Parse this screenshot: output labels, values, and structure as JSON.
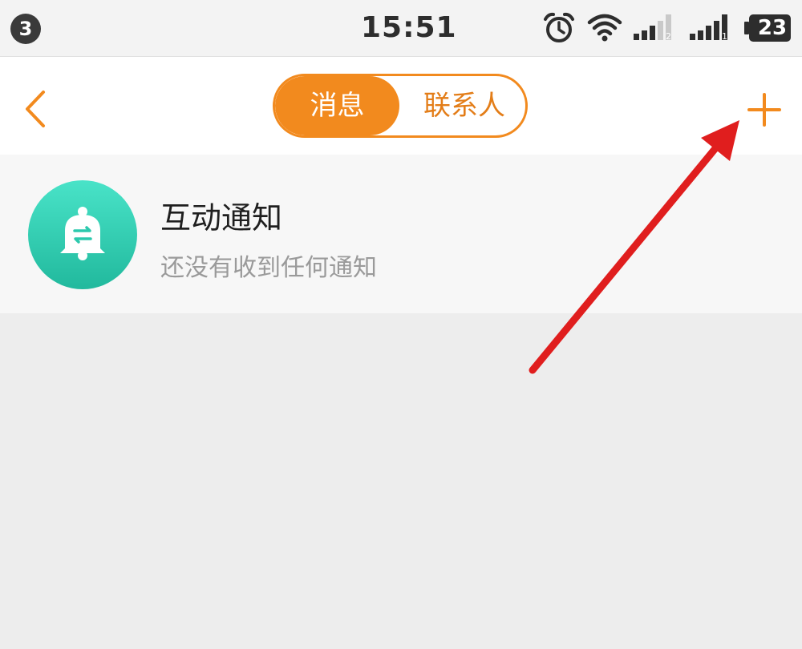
{
  "status_bar": {
    "notification_count": "3",
    "time": "15:51",
    "battery_level": "23",
    "icons": [
      "alarm-icon",
      "wifi-icon",
      "signal-sim1-icon",
      "signal-sim2-icon",
      "battery-icon"
    ]
  },
  "nav": {
    "back_icon": "chevron-left-icon",
    "tabs": [
      {
        "label": "消息",
        "selected": true
      },
      {
        "label": "联系人",
        "selected": false
      }
    ],
    "add_icon": "plus-icon"
  },
  "list": {
    "items": [
      {
        "title": "互动通知",
        "subtitle": "还没有收到任何通知",
        "icon": "bell-icon"
      }
    ]
  },
  "colors": {
    "accent": "#f28a1e",
    "avatar": "#2cc9ad",
    "annotation": "#e01e1e"
  }
}
